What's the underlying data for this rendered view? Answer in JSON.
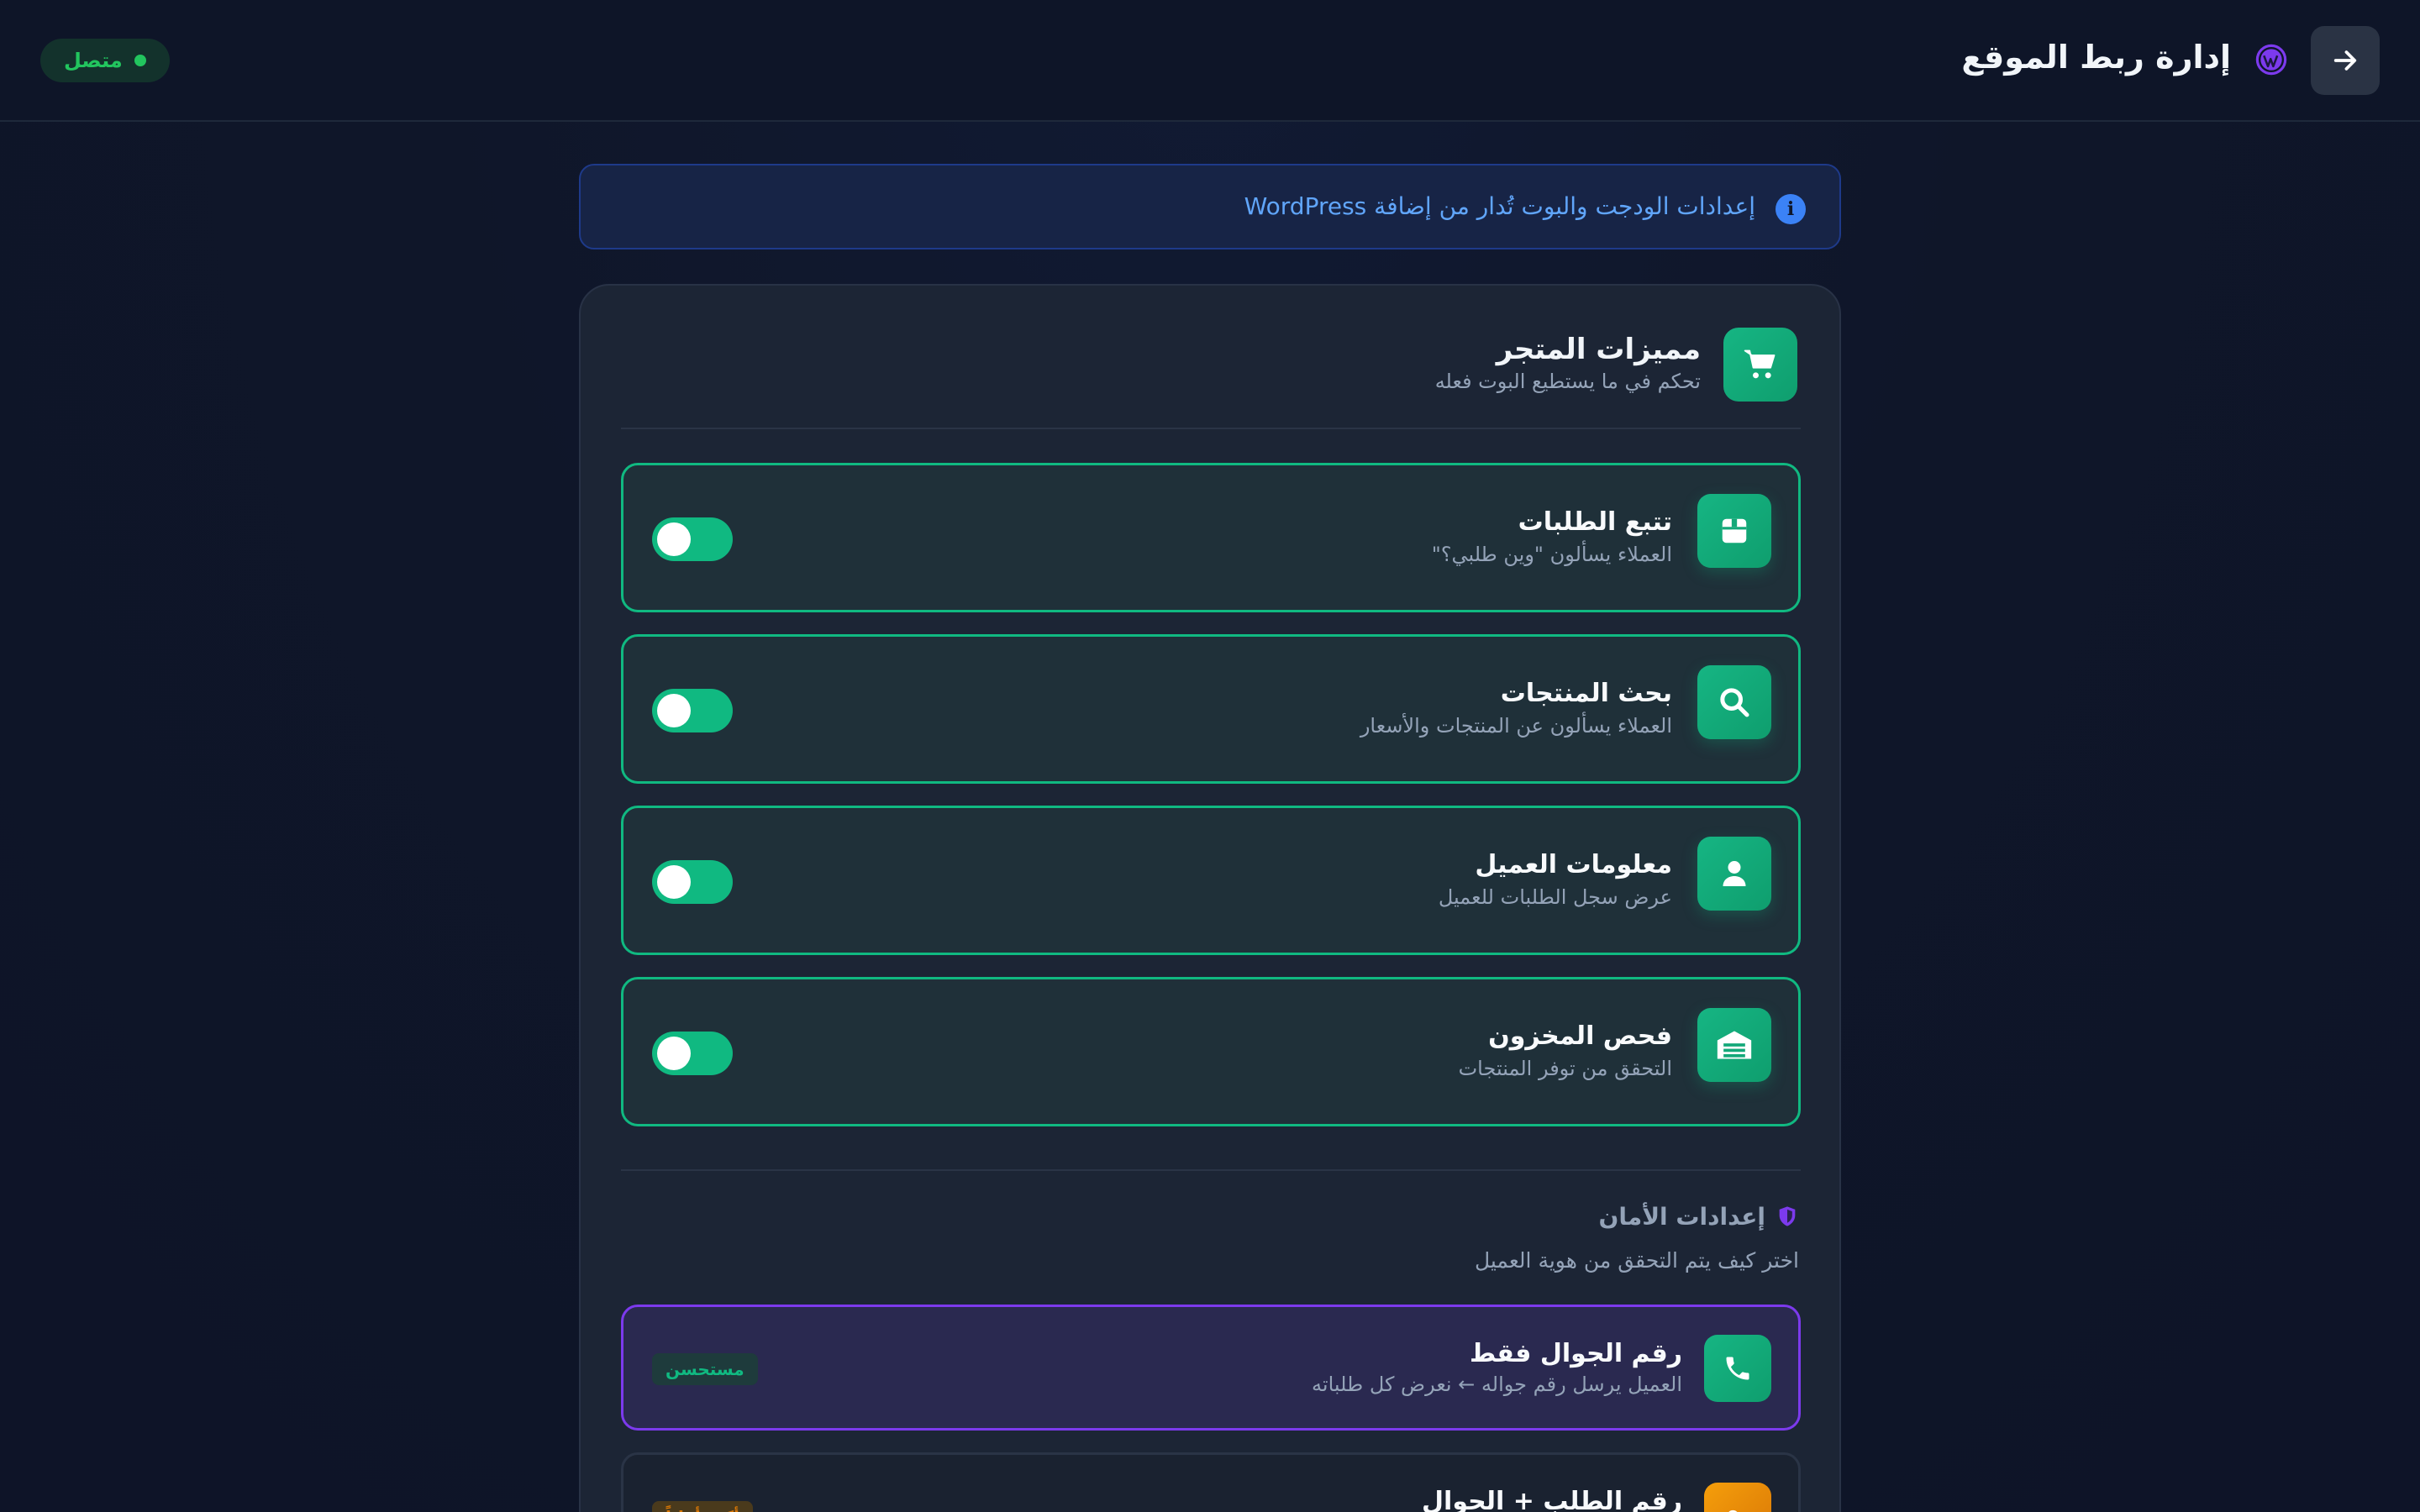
{
  "header": {
    "title": "إدارة ربط الموقع",
    "status": "متصل",
    "back_icon": "arrow-right-icon",
    "platform_icon": "wordpress-icon"
  },
  "info_banner": {
    "text": "إعدادات الودجت والبوت تُدار من إضافة WordPress",
    "icon": "info-icon"
  },
  "store_features": {
    "title": "مميزات المتجر",
    "subtitle": "تحكم في ما يستطيع البوت فعله",
    "icon": "cart-icon",
    "items": [
      {
        "title": "تتبع الطلبات",
        "description": "العملاء يسألون \"وين طلبي؟\"",
        "icon": "box-icon",
        "enabled": true
      },
      {
        "title": "بحث المنتجات",
        "description": "العملاء يسألون عن المنتجات والأسعار",
        "icon": "search-icon",
        "enabled": true
      },
      {
        "title": "معلومات العميل",
        "description": "عرض سجل الطلبات للعميل",
        "icon": "user-icon",
        "enabled": true
      },
      {
        "title": "فحص المخزون",
        "description": "التحقق من توفر المنتجات",
        "icon": "warehouse-icon",
        "enabled": true
      }
    ]
  },
  "security": {
    "title": "إعدادات الأمان",
    "subtitle": "اختر كيف يتم التحقق من هوية العميل",
    "icon": "shield-icon",
    "options": [
      {
        "title": "رقم الجوال فقط",
        "description": "العميل يرسل رقم جواله ← نعرض كل طلباته",
        "badge": "مستحسن",
        "icon": "phone-icon",
        "selected": true
      },
      {
        "title": "رقم الطلب + الجوال",
        "description": "",
        "badge": "أكثر أماناً",
        "icon": "key-icon",
        "selected": false
      }
    ]
  },
  "colors": {
    "accent_green": "#10b981",
    "accent_purple": "#7c3aed",
    "status_green": "#22c55e",
    "info_blue": "#3b82f6"
  }
}
